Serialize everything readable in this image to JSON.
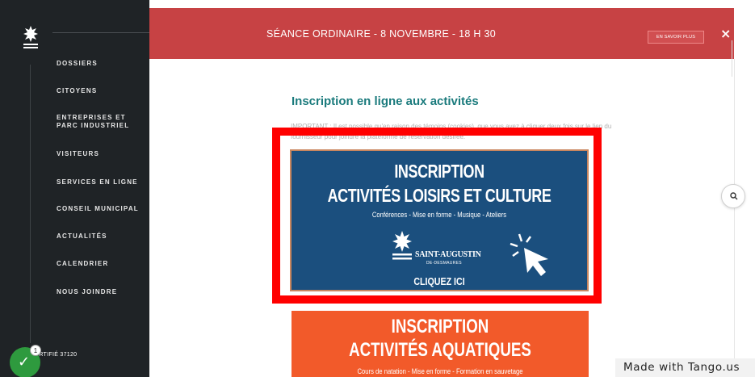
{
  "banner": {
    "title": "SÉANCE ORDINAIRE - 8 NOVEMBRE - 18 H 30",
    "more_label": "EN SAVOIR PLUS",
    "close_glyph": "×"
  },
  "sidebar": {
    "items": [
      {
        "label": "DOSSIERS"
      },
      {
        "label": "CITOYENS"
      },
      {
        "label": "ENTREPRISES ET PARC INDUSTRIEL"
      },
      {
        "label": "VISITEURS"
      },
      {
        "label": "SERVICES EN LIGNE"
      },
      {
        "label": "CONSEIL MUNICIPAL"
      },
      {
        "label": "ACTUALITÉS"
      },
      {
        "label": "CALENDRIER"
      },
      {
        "label": "NOUS JOINDRE"
      }
    ],
    "certified": "CERTIFIÉ 37120",
    "badge_count": "1",
    "badge_glyph": "✓"
  },
  "main": {
    "heading": "Inscription en ligne aux activités",
    "important": "IMPORTANT : Il est possible qu'en raison des témoins (cookies), que vous ayez à cliquer deux fois sur le lien du fournisseur pour joindre la plateforme de réservation désirée."
  },
  "card_leisure": {
    "line1": "INSCRIPTION",
    "line2": "ACTIVITÉS LOISIRS ET CULTURE",
    "subtitle": "Conférences - Mise en forme - Musique - Ateliers",
    "org_name": "SAINT-AUGUSTIN",
    "org_sub": "DE-DESMAURES",
    "cta": "CLIQUEZ ICI"
  },
  "card_aquatic": {
    "line1": "INSCRIPTION",
    "line2": "ACTIVITÉS AQUATIQUES",
    "subtitle": "Cours de natation - Mise en forme - Formation en sauvetage"
  },
  "watermark": "Made with Tango.us",
  "colors": {
    "sidebar_bg": "#1f2326",
    "banner_bg": "#c74244",
    "heading": "#1b7b7d",
    "card_blue": "#1b4f7e",
    "card_orange": "#f25a2a",
    "highlight": "#ff0000",
    "badge": "#2e9a3e"
  }
}
